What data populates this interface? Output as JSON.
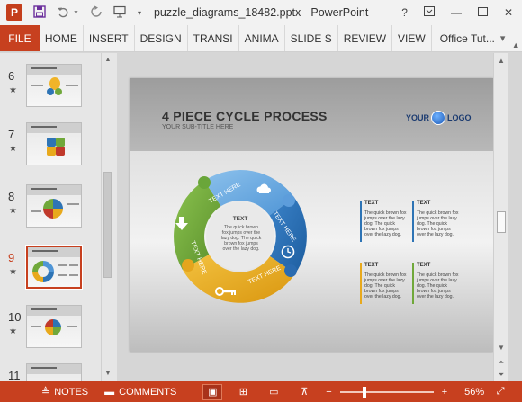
{
  "titlebar": {
    "app_icon": "P",
    "document_title": "puzzle_diagrams_18482.pptx - PowerPoint",
    "icons": [
      "save-icon",
      "undo-icon",
      "redo-icon",
      "start-from-beginning-icon",
      "customize-qat-icon"
    ],
    "window_controls": [
      "?",
      "restore",
      "minimize",
      "maximize",
      "close"
    ]
  },
  "ribbon": {
    "file_label": "FILE",
    "tabs": [
      "HOME",
      "INSERT",
      "DESIGN",
      "TRANSI",
      "ANIMA",
      "SLIDE S",
      "REVIEW",
      "VIEW"
    ],
    "account_label": "Office Tut..."
  },
  "thumbnails": [
    {
      "number": "6",
      "active": false
    },
    {
      "number": "7",
      "active": false
    },
    {
      "number": "8",
      "active": false
    },
    {
      "number": "9",
      "active": true
    },
    {
      "number": "10",
      "active": false
    },
    {
      "number": "11",
      "active": false
    }
  ],
  "slide": {
    "title": "4 PIECE CYCLE PROCESS",
    "subtitle": "YOUR SUB-TITLE HERE",
    "logo_left": "YOUR",
    "logo_right": "LOGO",
    "center_title": "TEXT",
    "center_body": "The quick brown fox jumps over the lazy dog. The quick brown fox jumps over the lazy dog.",
    "piece_labels": [
      "TEXT HERE",
      "TEXT HERE",
      "TEXT HERE",
      "TEXT HERE"
    ],
    "piece_icons": [
      "cloud-icon",
      "clock-icon",
      "key-icon",
      "arrow-down-icon"
    ],
    "colors": {
      "blue": "#2e74b5",
      "yellow": "#e8a91c",
      "green": "#70a83a",
      "lightblue": "#4f95d6"
    },
    "text_blocks": [
      {
        "title": "TEXT",
        "body": "The quick brown fox jumps over the lazy dog. The quick brown fox jumps over the lazy dog.",
        "accent": "#2e74b5"
      },
      {
        "title": "TEXT",
        "body": "The quick brown fox jumps over the lazy dog. The quick brown fox jumps over the lazy dog.",
        "accent": "#2e74b5"
      },
      {
        "title": "TEXT",
        "body": "The quick brown fox jumps over the lazy dog. The quick brown fox jumps over the lazy dog.",
        "accent": "#e8a91c"
      },
      {
        "title": "TEXT",
        "body": "The quick brown fox jumps over the lazy dog. The quick brown fox jumps over the lazy dog.",
        "accent": "#70a83a"
      }
    ]
  },
  "statusbar": {
    "notes_label": "NOTES",
    "comments_label": "COMMENTS",
    "zoom_minus": "−",
    "zoom_plus": "+",
    "zoom_percent": "56%",
    "zoom_level": 0.56
  }
}
